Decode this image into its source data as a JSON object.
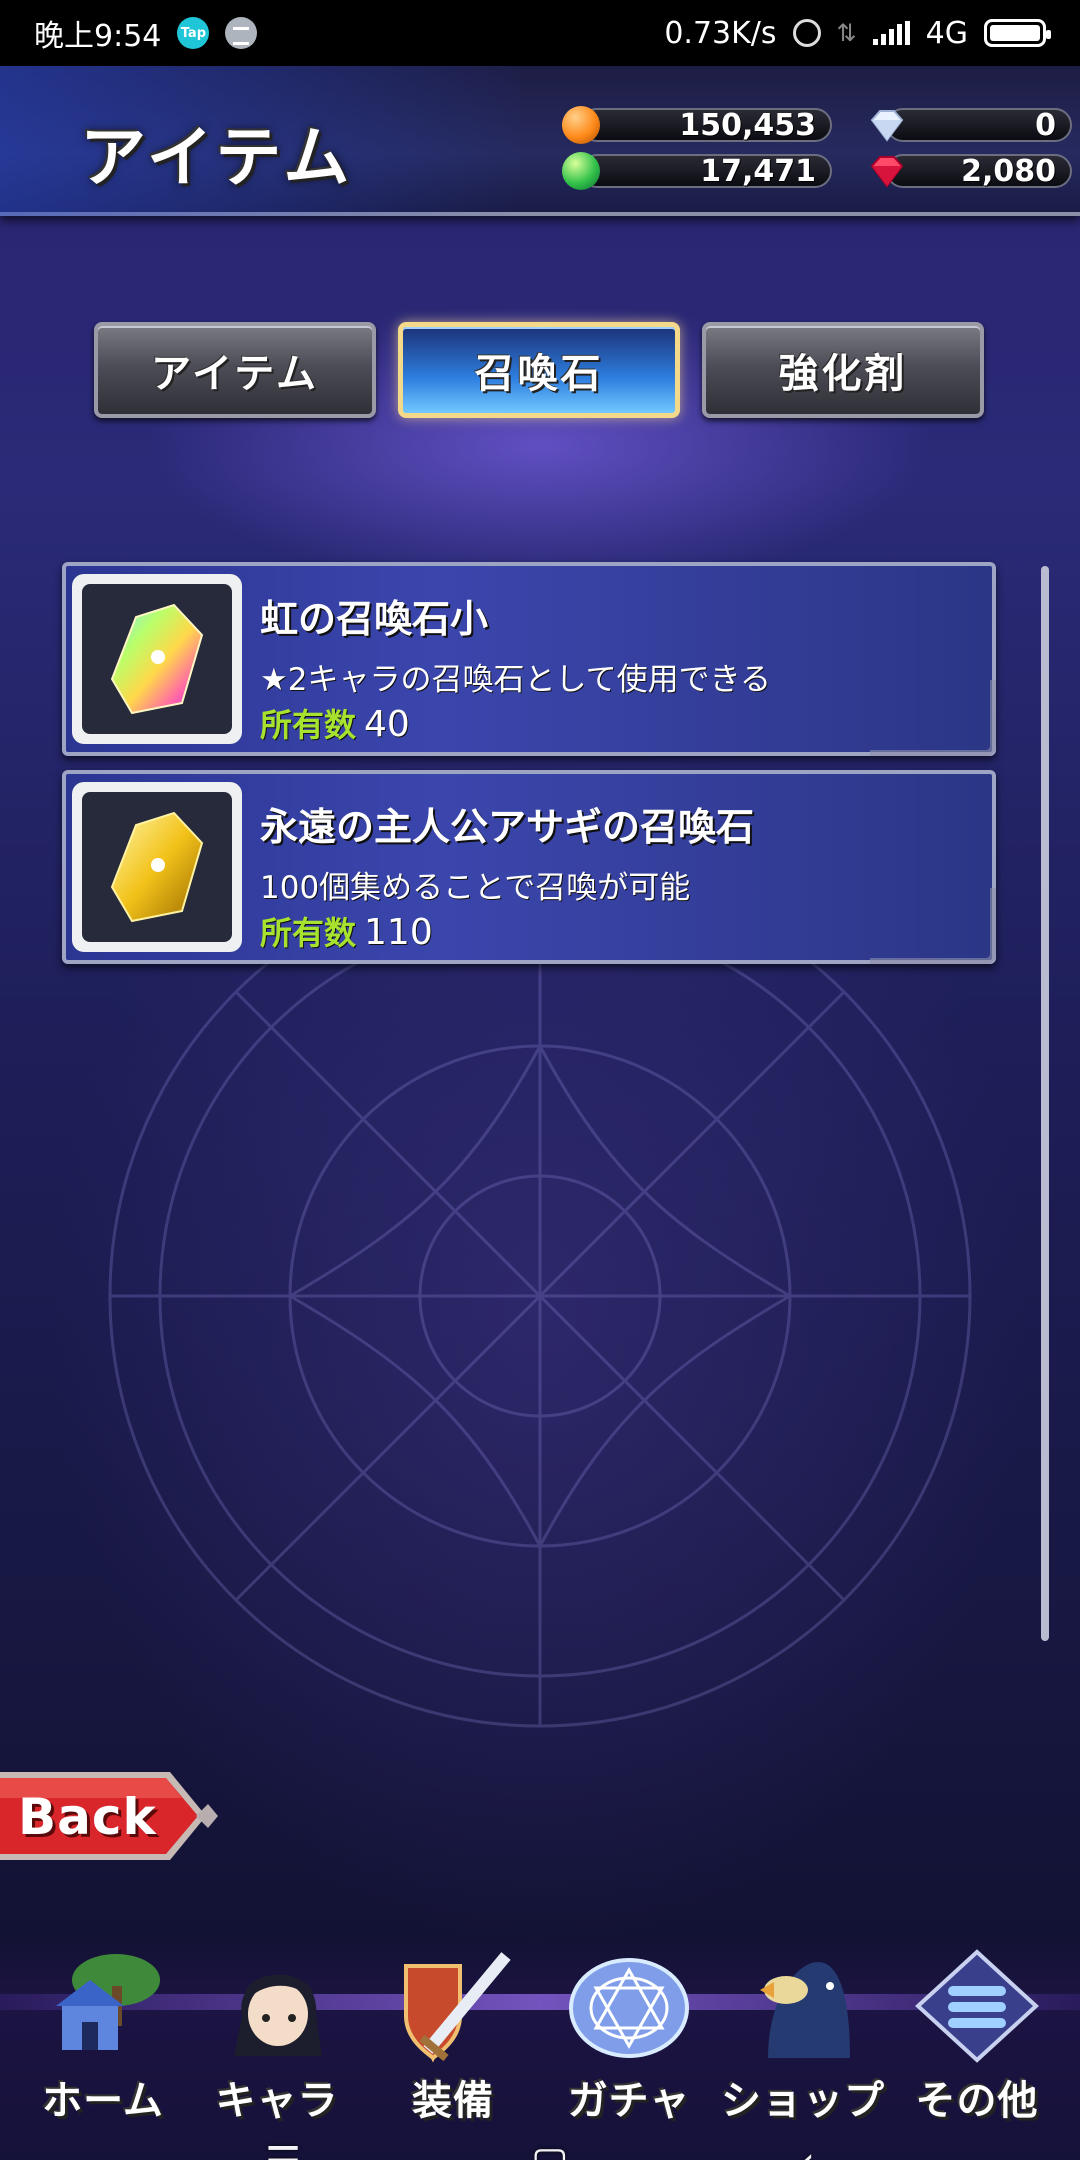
{
  "status_bar": {
    "time": "晚上9:54",
    "tap_badge": "Tap",
    "net_speed": "0.73K/s",
    "network": "4G"
  },
  "header": {
    "title": "アイテム",
    "currencies": {
      "gil": "150,453",
      "green_orb": "17,471",
      "diamond": "0",
      "ruby": "2,080"
    }
  },
  "tabs": [
    {
      "label": "アイテム",
      "active": false
    },
    {
      "label": "召喚石",
      "active": true
    },
    {
      "label": "強化剤",
      "active": false
    }
  ],
  "items": [
    {
      "name": "虹の召喚石小",
      "description": "★2キャラの召喚石として使用できる",
      "count_label": "所有数",
      "count": "40",
      "icon": "rainbow-crystal-icon"
    },
    {
      "name": "永遠の主人公アサギの召喚石",
      "description": "100個集めることで召喚が可能",
      "count_label": "所有数",
      "count": "110",
      "icon": "gold-crystal-icon"
    }
  ],
  "back_label": "Back",
  "menu": [
    {
      "label": "ホーム",
      "icon": "home-icon"
    },
    {
      "label": "キャラ",
      "icon": "character-icon"
    },
    {
      "label": "装備",
      "icon": "equipment-icon"
    },
    {
      "label": "ガチャ",
      "icon": "gacha-icon"
    },
    {
      "label": "ショップ",
      "icon": "shop-icon"
    },
    {
      "label": "その他",
      "icon": "other-icon"
    }
  ],
  "nav": {
    "menu_glyph": "☰",
    "home_glyph": "▢",
    "back_glyph": "‹"
  },
  "colors": {
    "count_label": "#a6e22e",
    "active_tab_border": "#f5d98a",
    "back_button": "#d8262b"
  }
}
